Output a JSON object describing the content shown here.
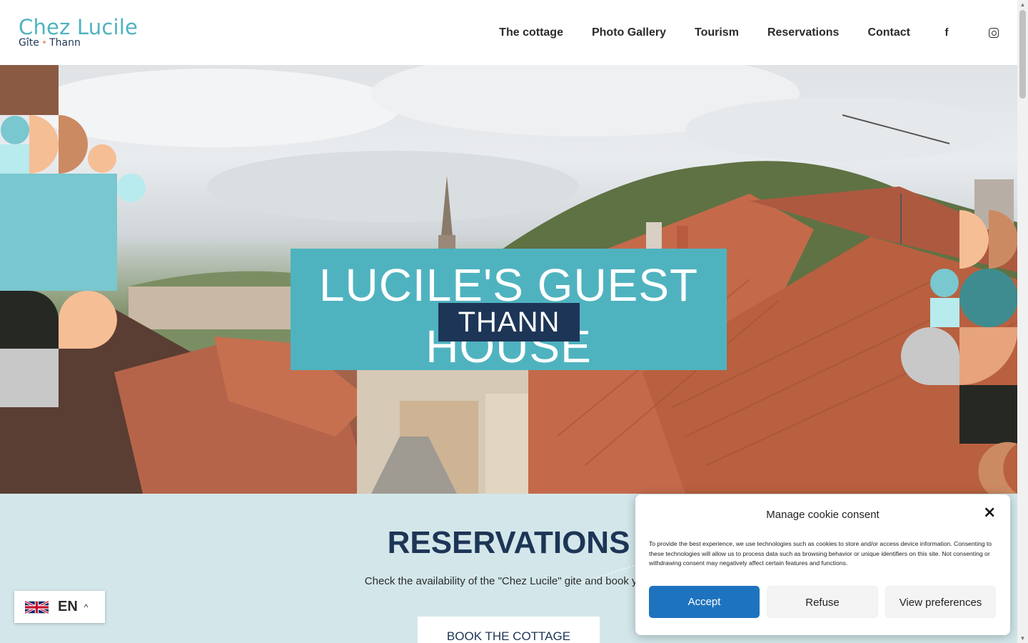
{
  "header": {
    "logo_main": "Chez Lucile",
    "logo_sub_left": "Gîte",
    "logo_sub_right": "Thann",
    "nav": [
      {
        "label": "The cottage"
      },
      {
        "label": "Photo Gallery"
      },
      {
        "label": "Tourism"
      },
      {
        "label": "Reservations"
      },
      {
        "label": "Contact"
      }
    ],
    "social": {
      "facebook_glyph": "f",
      "facebook_icon": "facebook-icon",
      "instagram_icon": "instagram-icon"
    }
  },
  "hero": {
    "title": "LUCILE'S GUEST HOUSE",
    "badge": "THANN"
  },
  "reservations": {
    "title": "RESERVATIONS",
    "text": "Check the availability of the \"Chez Lucile\" gite and book your",
    "button": "BOOK THE COTTAGE"
  },
  "language": {
    "code": "EN",
    "caret": "^"
  },
  "cookie": {
    "title": "Manage cookie consent",
    "close": "×",
    "body": "To provide the best experience, we use technologies such as cookies to store and/or access device information. Consenting to these technologies will allow us to process data such as browsing behavior or unique identifiers on this site. Not consenting or withdrawing consent may negatively affect certain features and functions.",
    "accept": "Accept",
    "refuse": "Refuse",
    "preferences": "View preferences"
  },
  "colors": {
    "teal": "#4fb3bf",
    "navy": "#1d3556",
    "accept_blue": "#1e73be",
    "peach": "#f6be95",
    "terracotta": "#cc8a62",
    "light_blue_bg": "#d3e7ea"
  }
}
